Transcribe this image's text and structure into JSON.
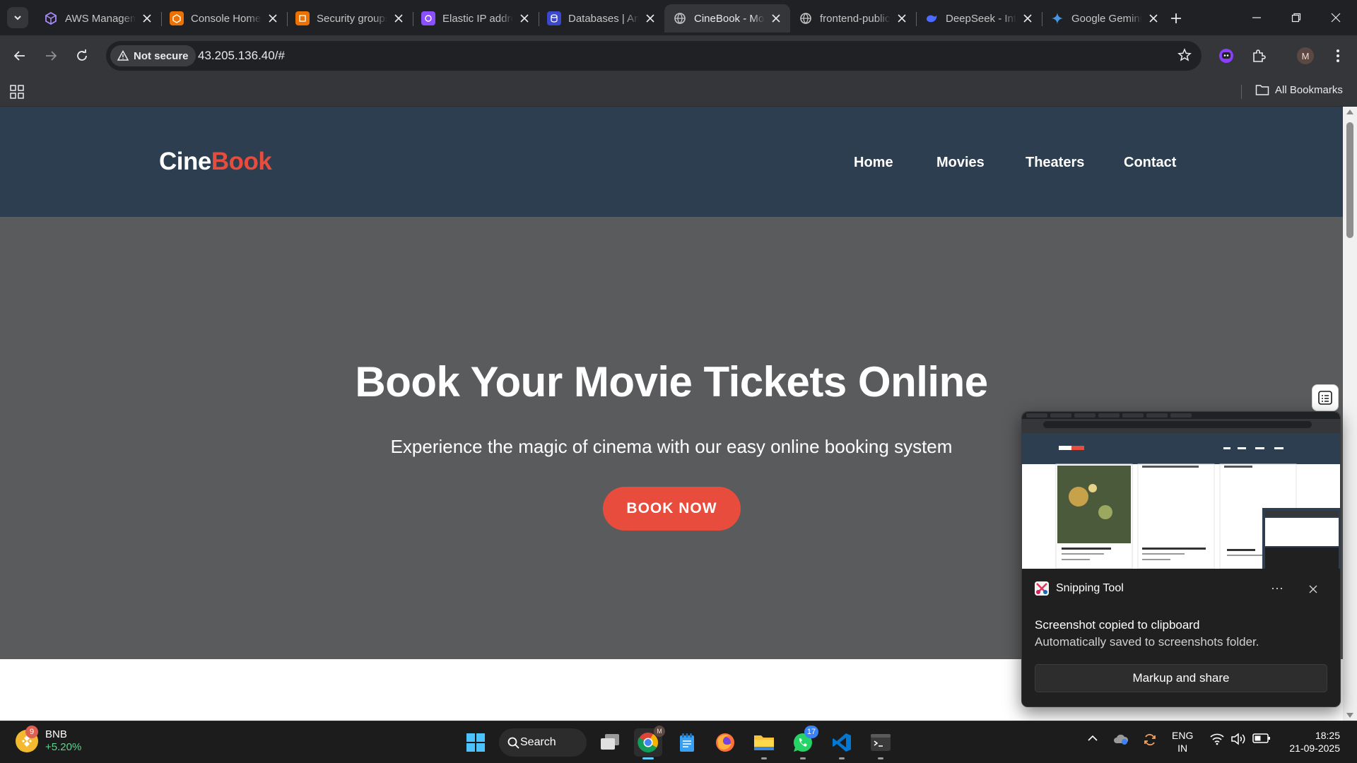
{
  "browser": {
    "tabs": [
      {
        "title": "AWS Management Console",
        "favicon": "aws-cube-icon",
        "color": "#8c4fff"
      },
      {
        "title": "Console Home",
        "favicon": "aws-console-icon",
        "color": "#ed7100"
      },
      {
        "title": "Security groups",
        "favicon": "aws-ec2-icon",
        "color": "#ed7100"
      },
      {
        "title": "Elastic IP addresses",
        "favicon": "aws-vpc-icon",
        "color": "#8c4fff"
      },
      {
        "title": "Databases | Amazon RDS",
        "favicon": "aws-rds-icon",
        "color": "#3b48cc"
      },
      {
        "title": "CineBook - Movie Booking",
        "favicon": "globe-icon",
        "color": "#c4c7c5",
        "active": true
      },
      {
        "title": "frontend-public",
        "favicon": "globe-icon",
        "color": "#c4c7c5"
      },
      {
        "title": "DeepSeek - Into the Unknown",
        "favicon": "deepseek-whale-icon",
        "color": "#4d6bfe"
      },
      {
        "title": "Google Gemini",
        "favicon": "gemini-star-icon",
        "color": "#4796e3"
      }
    ],
    "security_chip": "Not secure",
    "url": "43.205.136.40/#",
    "profile_initial": "M",
    "all_bookmarks": "All Bookmarks"
  },
  "site": {
    "logo_part1": "Cine",
    "logo_part2": "Book",
    "nav": [
      "Home",
      "Movies",
      "Theaters",
      "Contact"
    ],
    "hero_title": "Book Your Movie Tickets Online",
    "hero_subtitle": "Experience the magic of cinema with our easy online booking system",
    "cta": "BOOK NOW",
    "colors": {
      "header": "#2c3e50",
      "accent": "#e74c3c",
      "hero_overlay": "#5a5b5d"
    }
  },
  "toast": {
    "app_name": "Snipping Tool",
    "title": "Screenshot copied to clipboard",
    "subtitle": "Automatically saved to screenshots folder.",
    "button": "Markup and share",
    "more": "⋯"
  },
  "taskbar": {
    "widget_name": "BNB",
    "widget_change": "+5.20%",
    "widget_badge": "9",
    "search": "Search",
    "whatsapp_badge": "17",
    "chrome_profile": "M",
    "lang_line1": "ENG",
    "lang_line2": "IN",
    "time": "18:25",
    "date": "21-09-2025"
  }
}
